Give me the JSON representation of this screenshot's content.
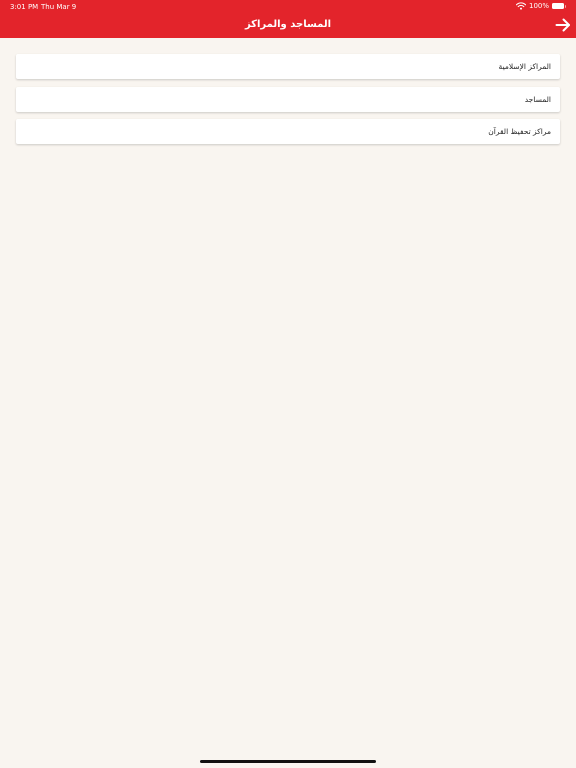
{
  "status_bar": {
    "time": "3:01 PM",
    "date": "Thu Mar 9",
    "battery": "100%",
    "wifi_icon": "wifi-icon",
    "battery_icon": "battery-icon"
  },
  "nav": {
    "title": "المساجد والمراكز",
    "back_icon": "arrow-right-icon"
  },
  "list": {
    "items": [
      {
        "label": "المراكز الإسلامية"
      },
      {
        "label": "المساجد"
      },
      {
        "label": "مراكز تحفيظ القرآن"
      }
    ]
  },
  "colors": {
    "header_bg": "#e3242b",
    "page_bg": "#f9f5f0",
    "card_bg": "#ffffff"
  }
}
